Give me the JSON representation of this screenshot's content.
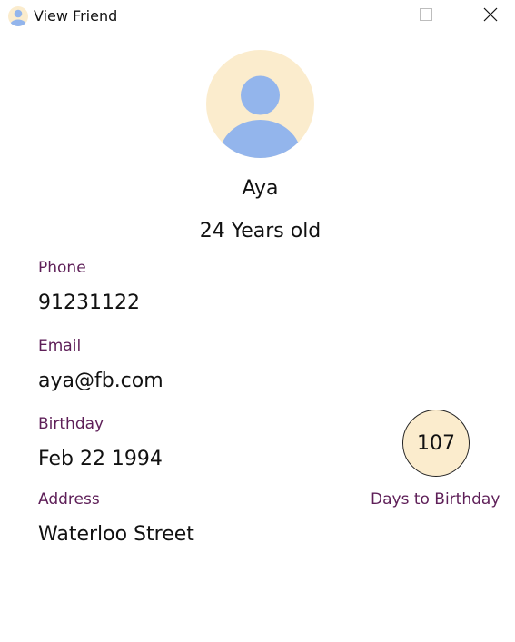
{
  "window": {
    "title": "View Friend",
    "icon": "user-avatar-icon"
  },
  "controls": {
    "minimize_icon": "minimize-icon",
    "maximize_icon": "maximize-icon",
    "close_icon": "close-icon"
  },
  "profile": {
    "avatar_icon": "person-silhouette-icon",
    "name": "Aya",
    "age_text": "24 Years old"
  },
  "fields": {
    "phone_label": "Phone",
    "phone_value": "91231122",
    "email_label": "Email",
    "email_value": "aya@fb.com",
    "birthday_label": "Birthday",
    "birthday_value": "Feb 22 1994",
    "address_label": "Address",
    "address_value": "Waterloo Street"
  },
  "birthday_countdown": {
    "days": "107",
    "label": "Days to Birthday"
  },
  "colors": {
    "label_color": "#5e1f58",
    "avatar_bg": "#fbeccd",
    "avatar_figure": "#93b5ec"
  }
}
